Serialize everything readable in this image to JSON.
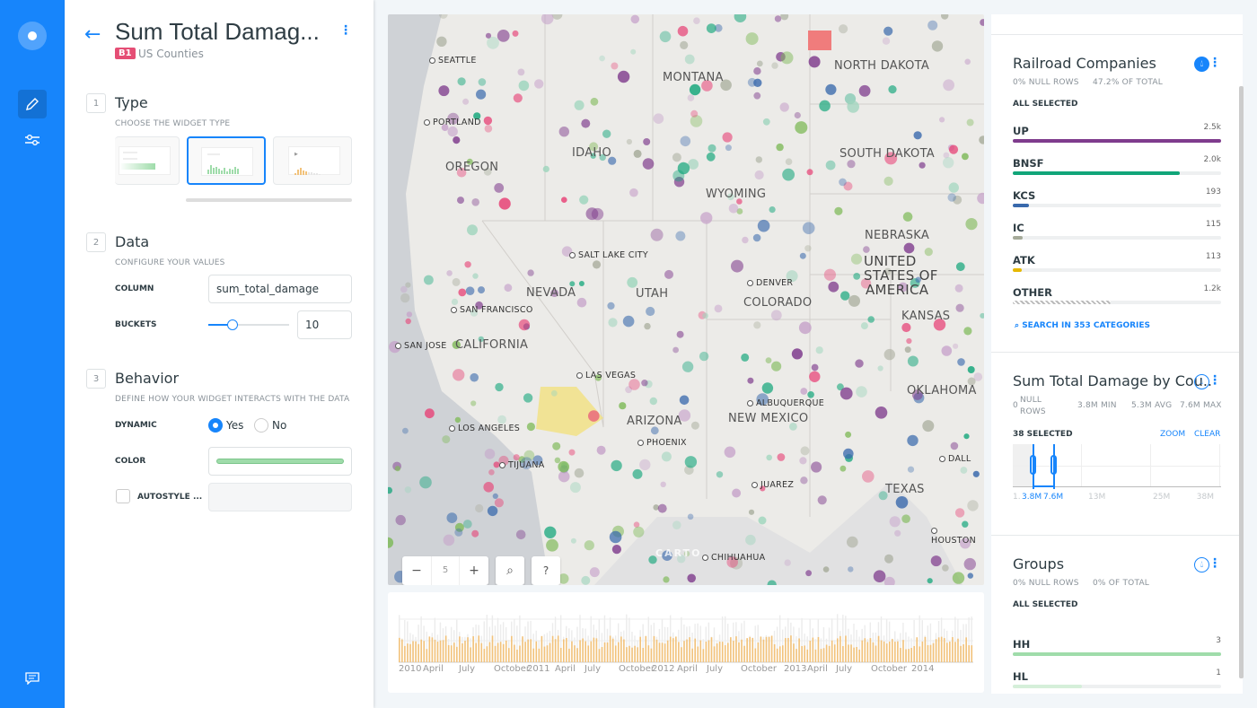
{
  "nav": {
    "items": [
      {
        "icon": "logo-icon"
      },
      {
        "icon": "pencil-icon"
      },
      {
        "icon": "sliders-icon"
      },
      {
        "icon": "chat-icon"
      }
    ]
  },
  "editor": {
    "title": "Sum Total Damag...",
    "layer_badge": "B1",
    "layer_name": "US Counties",
    "type": {
      "number": "1",
      "title": "Type",
      "subtitle": "CHOOSE THE WIDGET TYPE",
      "options": [
        "category",
        "histogram",
        "time-series"
      ],
      "selected": "histogram"
    },
    "data": {
      "number": "2",
      "title": "Data",
      "subtitle": "CONFIGURE YOUR VALUES",
      "column_label": "COLUMN",
      "column_value": "sum_total_damage",
      "buckets_label": "BUCKETS",
      "buckets_value": "10",
      "buckets_slider_fraction": 0.3
    },
    "behavior": {
      "number": "3",
      "title": "Behavior",
      "subtitle": "DEFINE HOW YOUR WIDGET INTERACTS WITH THE DATA",
      "dynamic_label": "DYNAMIC",
      "yes": "Yes",
      "no": "No",
      "dynamic_selected": "Yes",
      "color_label": "COLOR",
      "color": "#9fdcaa",
      "autostyle_label": "AUTOSTYLE ..."
    }
  },
  "map": {
    "states": [
      "MONTANA",
      "NORTH DAKOTA",
      "IDAHO",
      "OREGON",
      "SOUTH DAKOTA",
      "WYOMING",
      "NEBRASKA",
      "UNITED",
      "STATES OF",
      "AMERICA",
      "NEVADA",
      "UTAH",
      "COLORADO",
      "KANSAS",
      "CALIFORNIA",
      "ARIZONA",
      "NEW MEXICO",
      "OKLAHOMA",
      "TEXAS"
    ],
    "cities": [
      "SEATTLE",
      "PORTLAND",
      "SALT LAKE CITY",
      "DENVER",
      "SAN FRANCISCO",
      "SAN JOSE",
      "LAS VEGAS",
      "ALBUQUERQUE",
      "LOS ANGELES",
      "PHOENIX",
      "TIJUANA",
      "JUAREZ",
      "DALL",
      "HOUSTON",
      "CHIHUAHUA"
    ],
    "zoom": "5",
    "attribution": "CARTO",
    "controls": {
      "zoom_out": "−",
      "zoom_in": "+",
      "search": "⌕",
      "help": "?"
    }
  },
  "timeline": {
    "labels": [
      "2010",
      "April",
      "July",
      "October",
      "2011",
      "April",
      "July",
      "October",
      "2012",
      "April",
      "July",
      "October",
      "2013",
      "April",
      "July",
      "October",
      "2014"
    ],
    "bar_color": "#f2c27a"
  },
  "widgets": {
    "railroad": {
      "title": "Railroad Companies",
      "null_rows": "0% NULL ROWS",
      "of_total": "47.2% OF TOTAL",
      "status": "ALL SELECTED",
      "search": "SEARCH IN 353 CATEGORIES",
      "categories": [
        {
          "name": "UP",
          "value": "2.5k",
          "fraction": 1,
          "color": "#7f3c8d"
        },
        {
          "name": "BNSF",
          "value": "2.0k",
          "fraction": 0.8,
          "color": "#11a579"
        },
        {
          "name": "KCS",
          "value": "193",
          "fraction": 0.077,
          "color": "#3969ac"
        },
        {
          "name": "IC",
          "value": "115",
          "fraction": 0.046,
          "color": "#a5aa99"
        },
        {
          "name": "ATK",
          "value": "113",
          "fraction": 0.045,
          "color": "#e6b800"
        },
        {
          "name": "OTHER",
          "value": "1.2k",
          "fraction": 0.47,
          "color": "hatched"
        }
      ]
    },
    "histogram": {
      "title": "Sum Total Damage by Cou..",
      "null_value": "0",
      "null_label": "NULL ROWS",
      "min": "3.8M MIN",
      "avg": "5.3M AVG",
      "max": "7.6M MAX",
      "status": "38 SELECTED",
      "zoom": "ZOOM",
      "clear": "CLEAR",
      "axis": [
        "1.",
        "3.8M",
        "7.6M",
        "13M",
        "25M",
        "38M"
      ]
    },
    "groups": {
      "title": "Groups",
      "null_rows": "0% NULL ROWS",
      "of_total": "0% OF TOTAL",
      "status": "ALL SELECTED",
      "categories": [
        {
          "name": "HH",
          "value": "3",
          "fraction": 1,
          "color": "#9fdcaa"
        },
        {
          "name": "HL",
          "value": "1",
          "fraction": 0.33,
          "color": "#d5efd9"
        }
      ]
    }
  }
}
